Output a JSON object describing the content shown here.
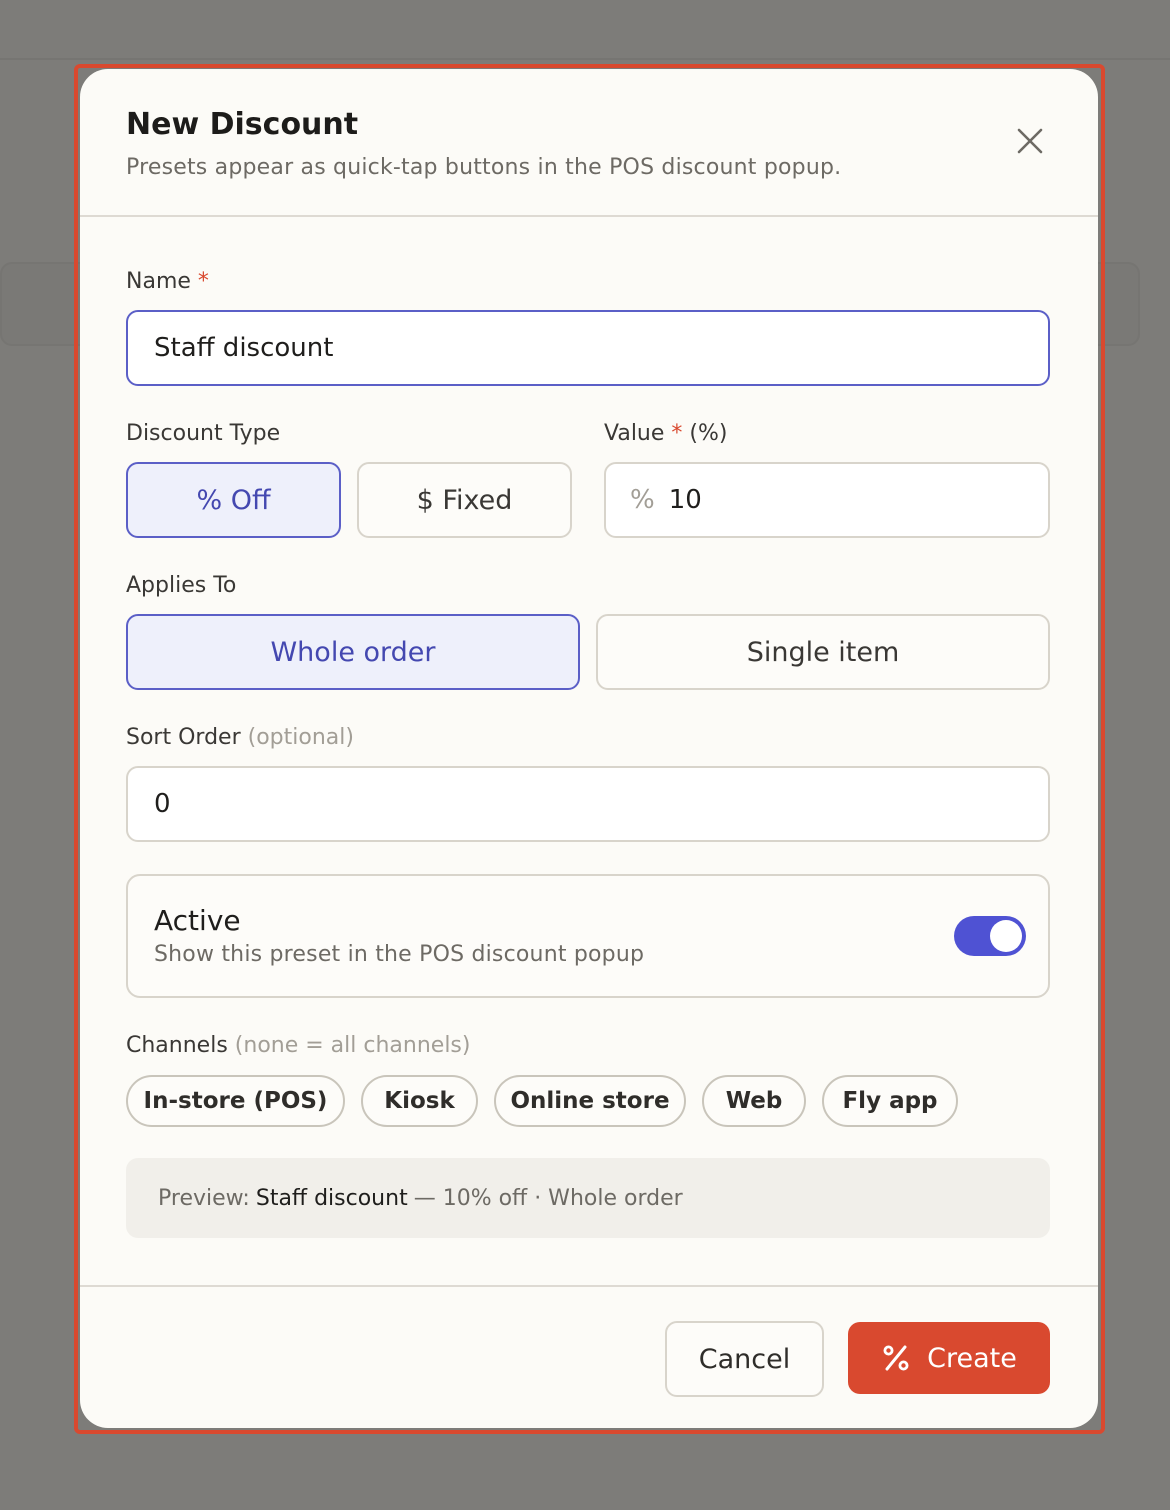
{
  "modal": {
    "title": "New Discount",
    "subtitle": "Presets appear as quick-tap buttons in the POS discount popup."
  },
  "name_field": {
    "label": "Name",
    "required_mark": "*",
    "value": "Staff discount"
  },
  "discount_type": {
    "label": "Discount Type",
    "options": [
      "% Off",
      "$ Fixed"
    ],
    "selected": "% Off"
  },
  "value_field": {
    "label": "Value",
    "required_mark": "*",
    "unit": "(%)",
    "prefix": "%",
    "value": "10"
  },
  "applies_to": {
    "label": "Applies To",
    "options": [
      "Whole order",
      "Single item"
    ],
    "selected": "Whole order"
  },
  "sort_order": {
    "label": "Sort Order",
    "hint": "(optional)",
    "value": "0"
  },
  "active": {
    "title": "Active",
    "description": "Show this preset in the POS discount popup",
    "enabled": true
  },
  "channels": {
    "label": "Channels",
    "hint": "(none = all channels)",
    "options": [
      "In-store (POS)",
      "Kiosk",
      "Online store",
      "Web",
      "Fly app"
    ]
  },
  "preview": {
    "prefix": "Preview:",
    "name": "Staff discount",
    "detail": "— 10% off · Whole order"
  },
  "footer": {
    "cancel_label": "Cancel",
    "create_label": "Create"
  },
  "colors": {
    "accent": "#d9492f",
    "selection": "#5b5fc7",
    "toggle_on": "#4f52d3"
  },
  "icons": {
    "close": "close-icon",
    "create": "percent-icon"
  }
}
